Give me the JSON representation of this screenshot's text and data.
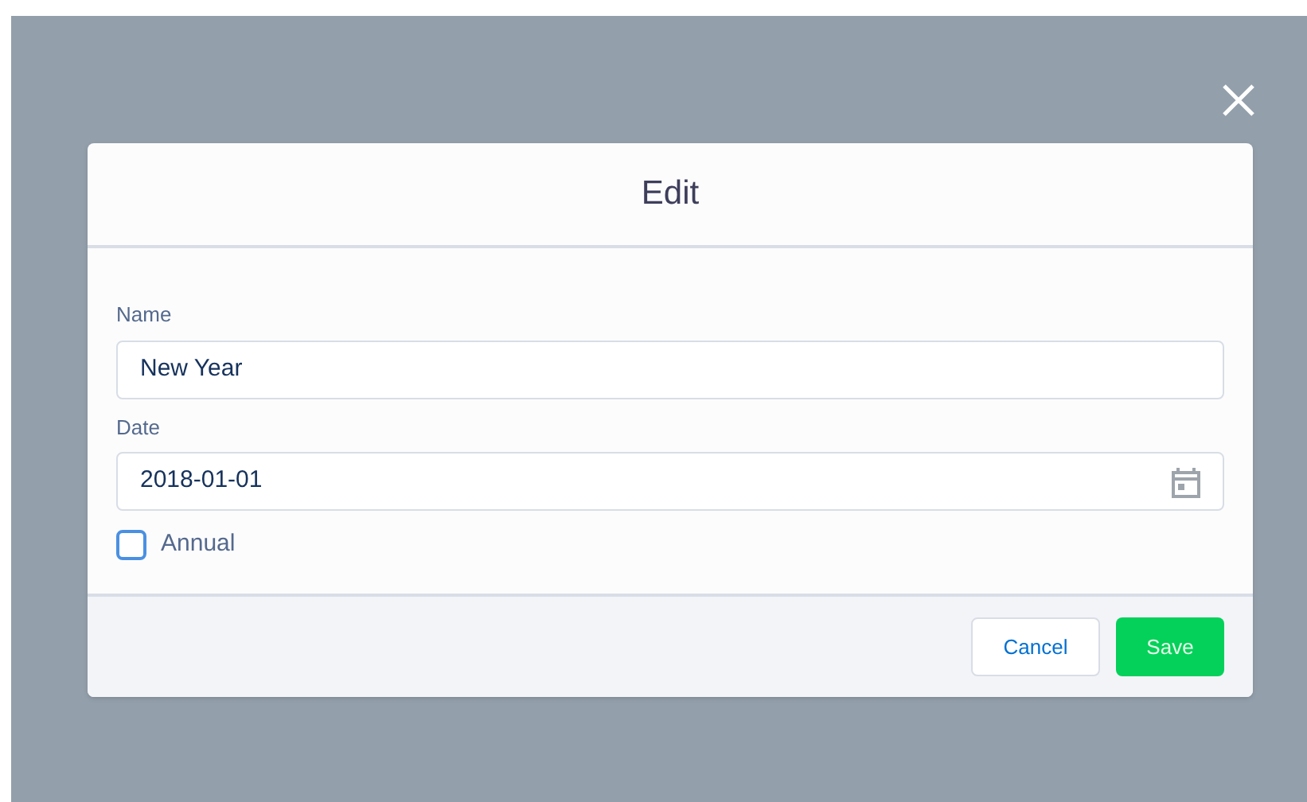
{
  "modal": {
    "title": "Edit"
  },
  "fields": [
    {
      "label": "Name",
      "value": "New Year",
      "kind": "text"
    },
    {
      "label": "Date",
      "value": "2018-01-01",
      "kind": "date"
    }
  ],
  "annual": {
    "label": "Annual",
    "checked": false
  },
  "buttons": [
    {
      "label": "Cancel",
      "kind": "neutral"
    },
    {
      "label": "Save",
      "kind": "brand"
    }
  ]
}
